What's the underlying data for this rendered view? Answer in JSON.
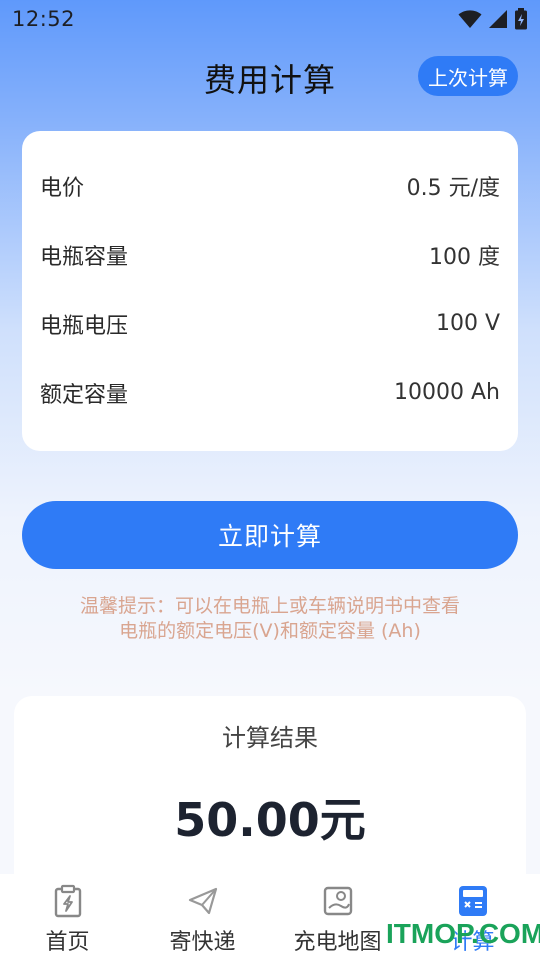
{
  "status_bar": {
    "time": "12:52"
  },
  "header": {
    "title": "费用计算",
    "history_button": "上次计算"
  },
  "form": {
    "rows": [
      {
        "label": "电价",
        "value": "0.5 元/度"
      },
      {
        "label": "电瓶容量",
        "value": "100 度"
      },
      {
        "label": "电瓶电压",
        "value": "100 V"
      },
      {
        "label": "额定容量",
        "value": "10000 Ah"
      }
    ]
  },
  "calculate_button": "立即计算",
  "tip": {
    "line1": "温馨提示：可以在电瓶上或车辆说明书中查看",
    "line2": "电瓶的额定电压(V)和额定容量 (Ah)"
  },
  "result": {
    "title": "计算结果",
    "value": "50.00元"
  },
  "tabbar": {
    "items": [
      {
        "label": "首页",
        "icon": "clipboard-bolt-icon"
      },
      {
        "label": "寄快递",
        "icon": "paper-plane-icon"
      },
      {
        "label": "充电地图",
        "icon": "map-icon"
      },
      {
        "label": "计算",
        "icon": "calculator-icon",
        "active": true
      }
    ]
  },
  "watermark": "ITMOP.COM",
  "colors": {
    "accent": "#2f7bf6",
    "tip": "#d9a590",
    "watermark": "#1aa35a"
  }
}
